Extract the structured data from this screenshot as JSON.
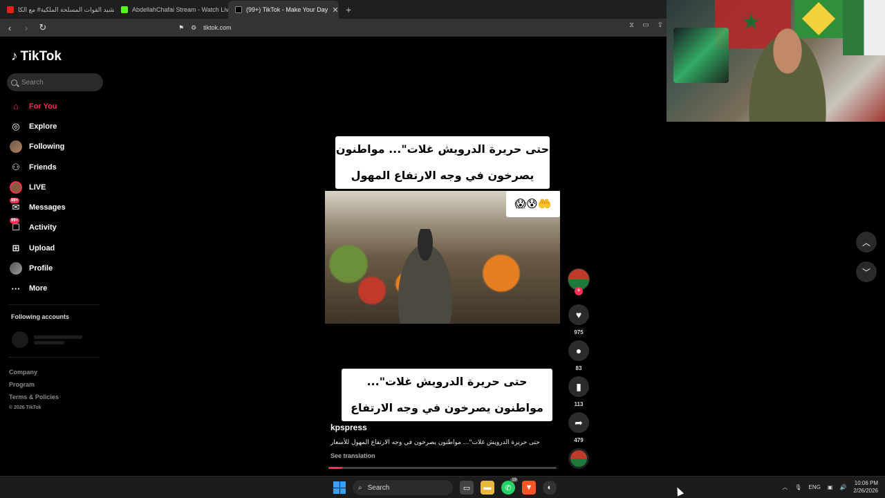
{
  "browser": {
    "tabs": [
      {
        "title": "نشيد القوات المسلحة الملكية# مع الكا",
        "icon": "youtube-icon",
        "color": "#e62117"
      },
      {
        "title": "AbdellahChafai Stream - Watch Live",
        "icon": "kick-icon",
        "color": "#53fc18"
      },
      {
        "title": "(99+) TikTok - Make Your Day",
        "icon": "tiktok-icon",
        "color": "#000000",
        "active": true
      }
    ],
    "new_tab_label": "+",
    "url": "tiktok.com"
  },
  "sidebar": {
    "logo": "TikTok",
    "search_placeholder": "Search",
    "items": [
      {
        "label": "For You",
        "icon": "home-icon",
        "active": true
      },
      {
        "label": "Explore",
        "icon": "compass-icon"
      },
      {
        "label": "Following",
        "icon": "avatar-icon"
      },
      {
        "label": "Friends",
        "icon": "friends-icon"
      },
      {
        "label": "LIVE",
        "icon": "live-icon"
      },
      {
        "label": "Messages",
        "icon": "messages-icon",
        "badge": "99+"
      },
      {
        "label": "Activity",
        "icon": "activity-icon",
        "badge": "99+"
      },
      {
        "label": "Upload",
        "icon": "upload-icon"
      },
      {
        "label": "Profile",
        "icon": "profile-avatar-icon"
      },
      {
        "label": "More",
        "icon": "more-icon"
      }
    ],
    "following_accounts": "Following accounts",
    "footer": {
      "company": "Company",
      "program": "Program",
      "terms": "Terms & Policies",
      "copyright": "© 2026 TikTok"
    }
  },
  "video": {
    "caption_top": "حتى حريرة الدرويش غلات\"... مواطنون يصرخون في وجه الارتفاع المهول للأسعار",
    "caption_bottom": "حتى حريرة الدرويش غلات\"... مواطنون يصرخون في وجه الارتفاع المهول للأسعار",
    "emoji": "😱😰🤲",
    "username": "kpspress",
    "description": "حتى حريرة الدرويش غلات\"... مواطنون يصرخون في وجه الارتفاع المهول للأسعار",
    "see_translation": "See translation",
    "progress_percent": 6
  },
  "actions": {
    "likes": "975",
    "comments": "83",
    "saves": "113",
    "shares": "479"
  },
  "taskbar": {
    "search_label": "Search",
    "lang": "ENG",
    "time": "10:06 PM",
    "date": "2/26/2026",
    "whatsapp_badge": "19"
  },
  "colors": {
    "accent": "#fe2c55",
    "background": "#000000"
  }
}
